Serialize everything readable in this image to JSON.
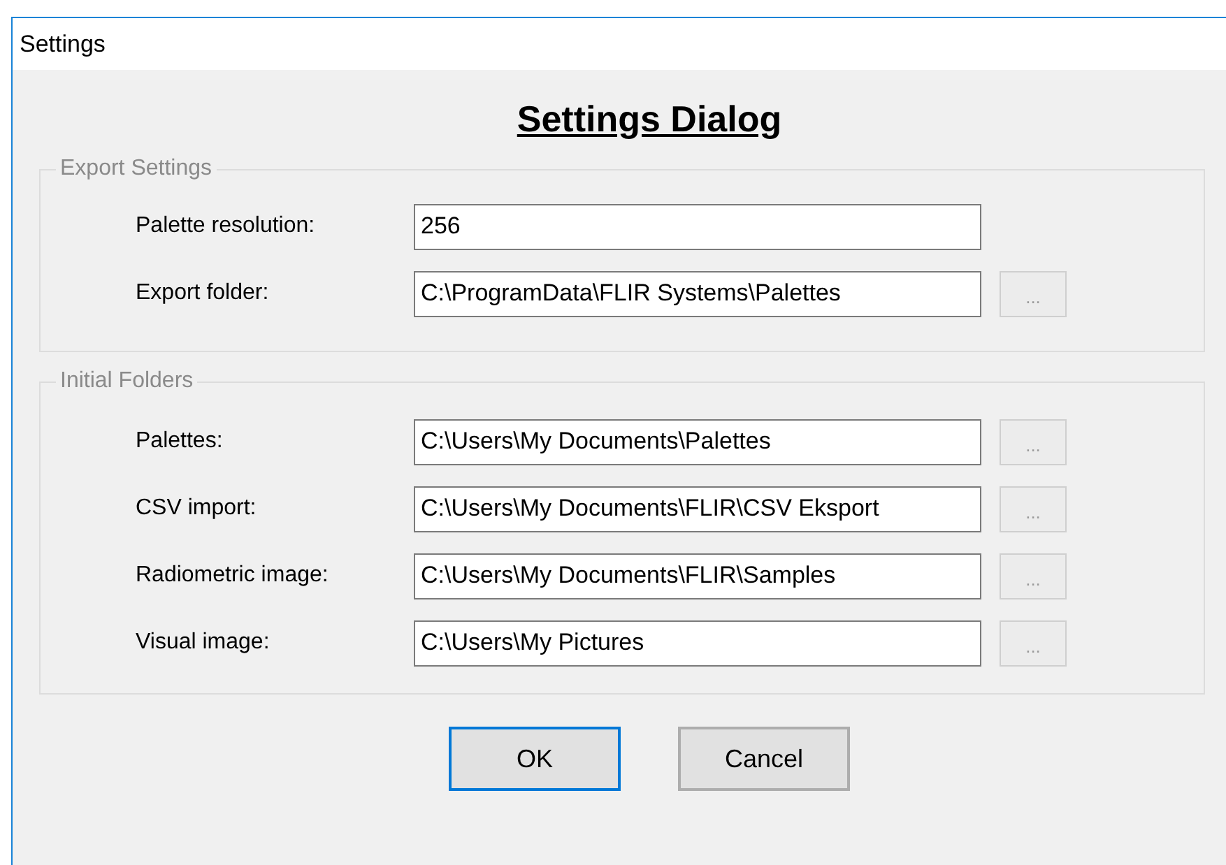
{
  "window": {
    "title": "Settings"
  },
  "heading": "Settings Dialog",
  "groups": [
    {
      "title": "Export Settings",
      "rows": [
        {
          "label": "Palette resolution:",
          "value": "256"
        },
        {
          "label": "Export folder:",
          "value": "C:\\ProgramData\\FLIR Systems\\Palettes",
          "browse": {
            "label": "...",
            "disabled": true
          }
        }
      ]
    },
    {
      "title": "Initial Folders",
      "rows": [
        {
          "label": "Palettes:",
          "value": "C:\\Users\\My Documents\\Palettes",
          "browse": {
            "label": "...",
            "disabled": true
          }
        },
        {
          "label": "CSV import:",
          "value": "C:\\Users\\My Documents\\FLIR\\CSV Eksport",
          "browse": {
            "label": "...",
            "disabled": true
          }
        },
        {
          "label": "Radiometric image:",
          "value": "C:\\Users\\My Documents\\FLIR\\Samples",
          "browse": {
            "label": "...",
            "disabled": true
          }
        },
        {
          "label": "Visual image:",
          "value": "C:\\Users\\My Pictures",
          "browse": {
            "label": "...",
            "disabled": true
          }
        }
      ]
    }
  ],
  "buttons": [
    {
      "label": "OK",
      "focused": true
    },
    {
      "label": "Cancel",
      "focused": false
    }
  ]
}
